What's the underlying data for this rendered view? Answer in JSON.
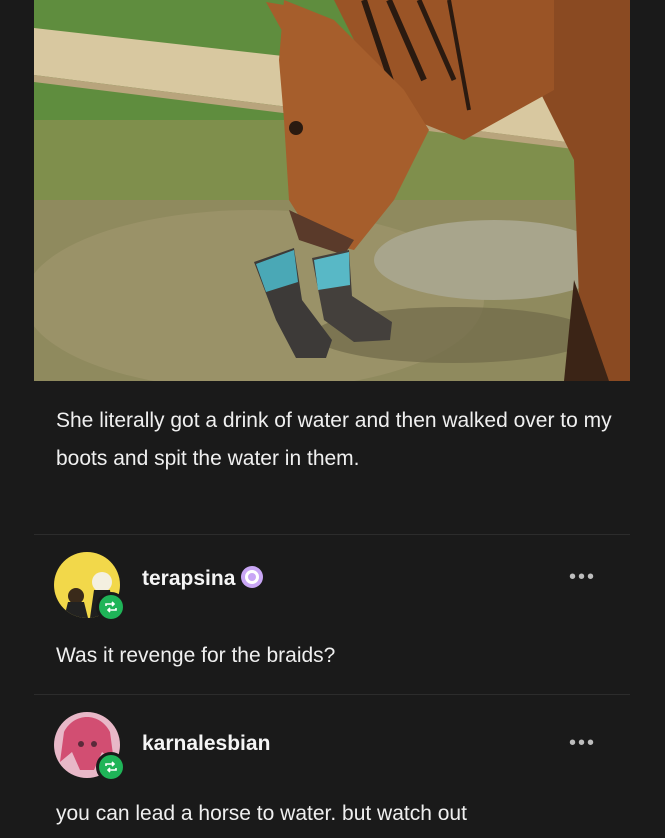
{
  "post": {
    "caption": "She literally got a drink of water and then walked over to my boots and spit the water in them."
  },
  "reblogs": [
    {
      "username": "terapsina",
      "comment": "Was it revenge for the braids?",
      "has_badge": true
    },
    {
      "username": "karnalesbian",
      "comment": "you can lead a horse to water. but watch out",
      "has_badge": false
    }
  ],
  "icons": {
    "more": "more-options-icon",
    "reblog": "reblog-icon",
    "badge": "verified-badge-icon"
  },
  "colors": {
    "background": "#1a1a1a",
    "reblog_badge": "#1fb458",
    "text": "#efefef"
  }
}
